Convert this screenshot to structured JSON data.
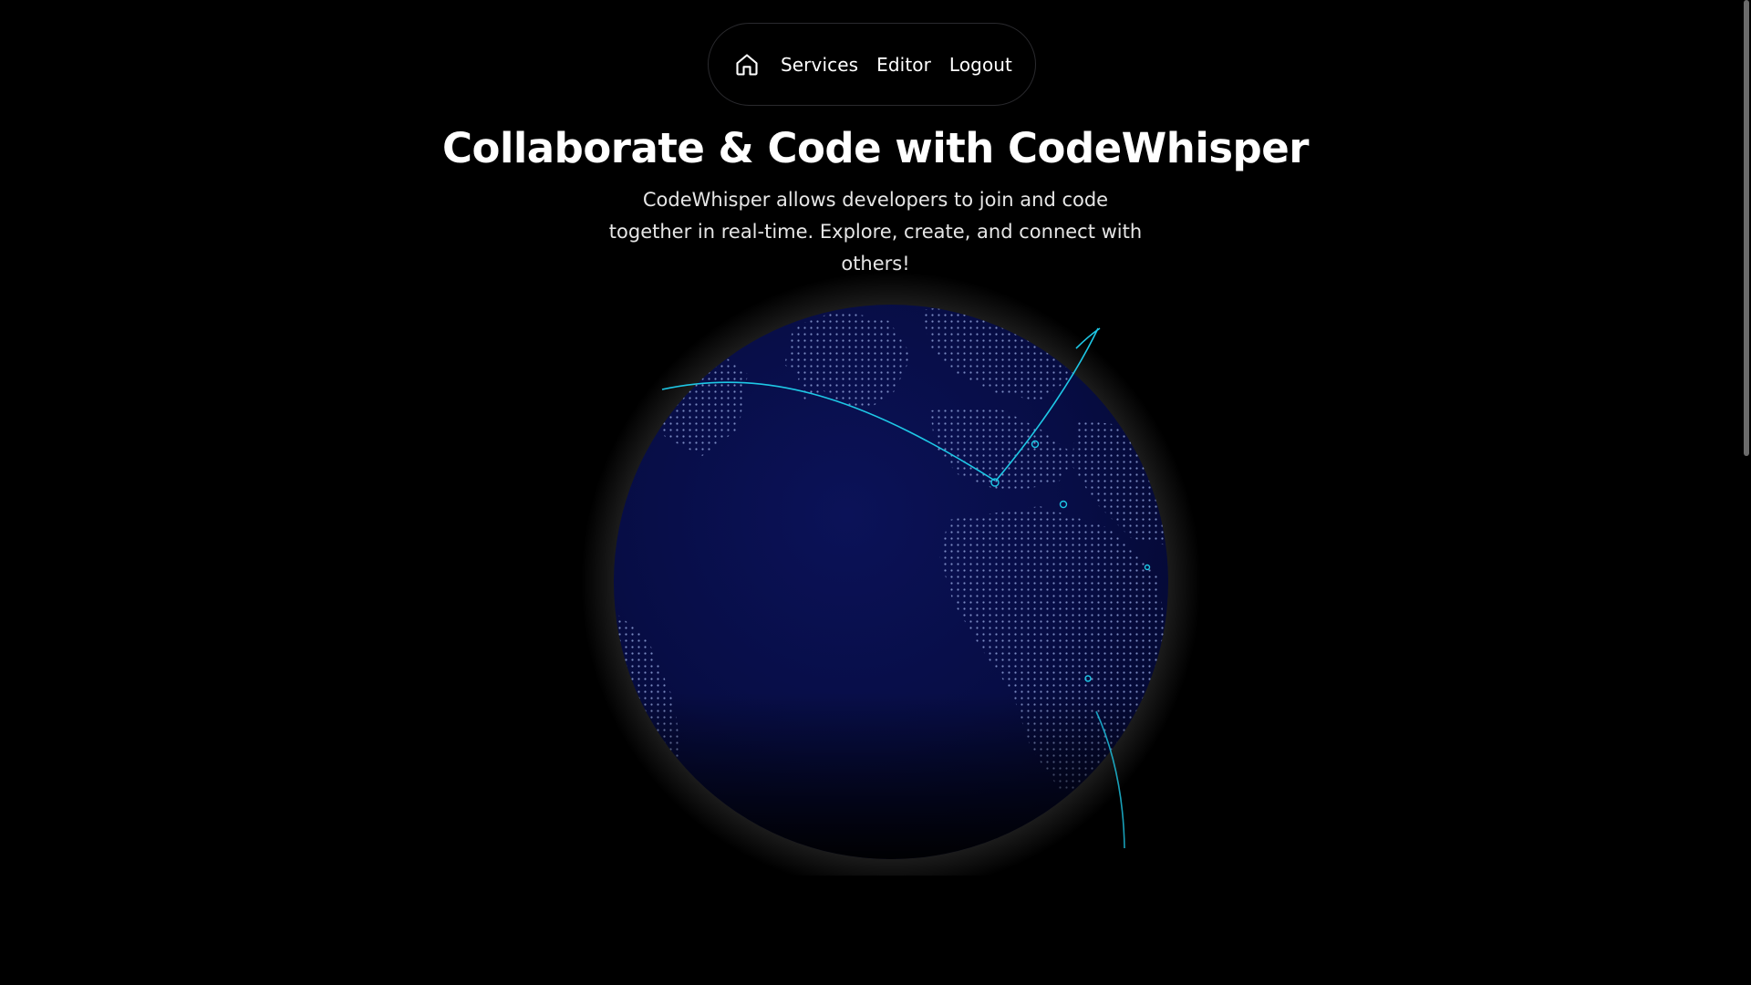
{
  "nav": {
    "home_icon": "home-icon",
    "links": [
      "Services",
      "Editor",
      "Logout"
    ]
  },
  "hero": {
    "title": "Collaborate & Code with CodeWhisper",
    "subtitle": "CodeWhisper allows developers to join and code together in real-time. Explore, create, and connect with others!"
  },
  "globe": {
    "ocean_color": "#0a0f4a",
    "dot_color": "#8fa0d8",
    "arc_color": "#1ec8e6",
    "glow_color": "#ffffff"
  }
}
